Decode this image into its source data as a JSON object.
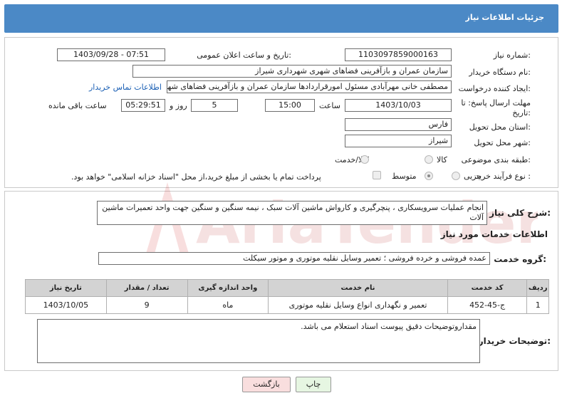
{
  "header": {
    "title": "جزئیات اطلاعات نیاز"
  },
  "form": {
    "need_number_label": "شماره نیاز:",
    "need_number": "1103097859000163",
    "announce_label": "تاریخ و ساعت اعلان عمومی:",
    "announce_value": "1403/09/28 - 07:51",
    "buyer_org_label": "نام دستگاه خریدار:",
    "buyer_org": "سازمان عمران و بازآفرینی فضاهای شهری شهرداری شیراز",
    "creator_label": "ایجاد کننده درخواست:",
    "creator": "مصطفی خانی مهرآبادی مسئول امورقراردادها سازمان عمران و بازآفرینی فضاهای شهری شهرداری شیراز",
    "contact_link": "اطلاعات تماس خریدار",
    "deadline_label_1": "مهلت ارسال پاسخ: تا",
    "deadline_label_2": "تاریخ:",
    "deadline_date": "1403/10/03",
    "time_label": "ساعت",
    "deadline_time": "15:00",
    "days_value": "5",
    "days_label": "روز و",
    "remaining_time": "05:29:51",
    "remaining_label": "ساعت باقی مانده",
    "province_label": "استان محل تحویل:",
    "province": "فارس",
    "city_label": "شهر محل تحویل:",
    "city": "شیراز",
    "category_label": "طبقه بندی موضوعی:",
    "category_options": [
      "کالا",
      "کالا/خدمت"
    ],
    "process_label": "نوع فرآیند خرید :",
    "process_options": [
      "جزیی",
      "متوسط"
    ],
    "payment_note": "پرداخت تمام یا بخشی از مبلغ خرید،از محل \"اسناد خزانه اسلامی\" خواهد بود."
  },
  "summary": {
    "label": "شرح کلی نیاز:",
    "text": "انجام عملیات سرویسکاری ، پنچرگیری و کارواش ماشین آلات سبک ، نیمه سنگین و سنگین جهت واحد تعمیرات ماشین آلات"
  },
  "services": {
    "section_title": "اطلاعات خدمات مورد نیاز",
    "group_label": "گروه خدمت:",
    "group_value": "عمده فروشی و خرده فروشی ؛ تعمیر وسایل نقلیه موتوری و موتور سیکلت",
    "columns": [
      "ردیف",
      "کد خدمت",
      "نام خدمت",
      "واحد اندازه گیری",
      "تعداد / مقدار",
      "تاریخ نیاز"
    ],
    "rows": [
      {
        "row": "1",
        "code": "ج-45-452",
        "name": "تعمیر و نگهداری انواع وسایل نقلیه موتوری",
        "unit": "ماه",
        "qty": "9",
        "date": "1403/10/05"
      }
    ]
  },
  "buyer_notes": {
    "label": "توضیحات خریدار:",
    "text": "مقداروتوضیحات دقیق پیوست اسناد استعلام می باشد."
  },
  "buttons": {
    "print": "چاپ",
    "back": "بازگشت"
  },
  "watermark": {
    "text": "AriaTender.neT"
  },
  "colors": {
    "header_bg": "#4b89c6",
    "table_header_bg": "#d3d3d3",
    "back_button_bg": "#f9dede",
    "print_button_bg": "#e6f6e2",
    "link": "#1a5fb4"
  }
}
